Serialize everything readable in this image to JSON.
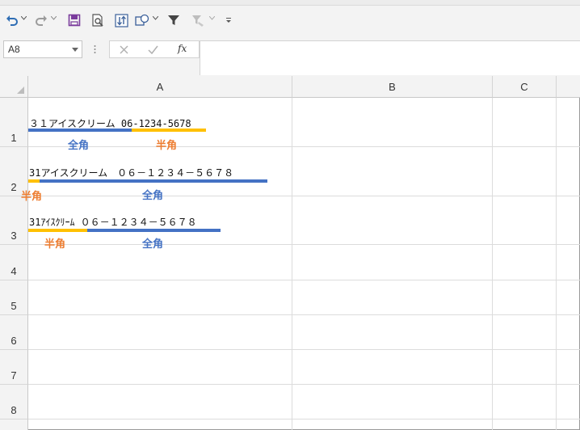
{
  "formula_bar": {
    "name_box": "A8",
    "fx_label": "fx",
    "formula": ""
  },
  "columns": [
    "A",
    "B",
    "C"
  ],
  "rows": [
    "1",
    "2",
    "3",
    "4",
    "5",
    "6",
    "7",
    "8"
  ],
  "cells": {
    "row1": "３１アイスクリーム 06-1234-5678",
    "row2": "31アイスクリーム　０６－１２３４－５６７８",
    "row3": "31ｱｲｽｸﾘｰﾑ ０６－１２３４－５６７８"
  },
  "annotations": {
    "row1": {
      "left": "全角",
      "right": "半角"
    },
    "row2": {
      "left": "半角",
      "right": "全角"
    },
    "row3": {
      "left": "半角",
      "right": "全角"
    }
  },
  "colors": {
    "zenkaku_blue": "#4472c4",
    "hankaku_orange": "#ed7d31",
    "bar_yellow": "#ffc000",
    "toolbar_bg": "#f3f3f3",
    "undo_blue": "#2e6db4",
    "save_purple": "#7a3b9c"
  },
  "icons": [
    "undo-icon",
    "redo-icon",
    "save-icon",
    "print-preview-icon",
    "sort-icon",
    "shapes-icon",
    "filter-icon",
    "clear-filter-icon",
    "customize-toolbar-icon"
  ]
}
